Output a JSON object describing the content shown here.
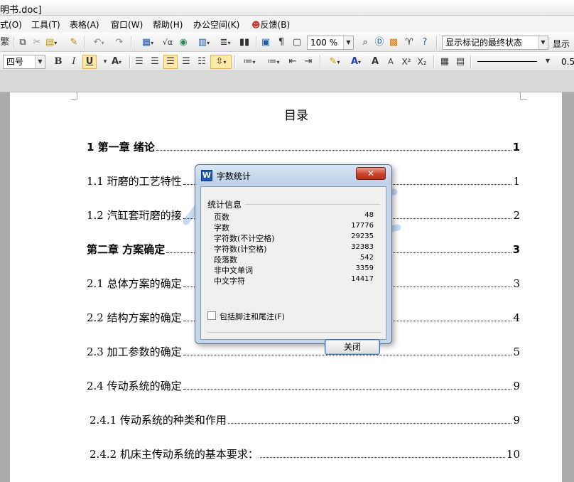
{
  "window": {
    "title": "明书.doc]"
  },
  "menu": [
    {
      "label": "式",
      "key": "(O)"
    },
    {
      "label": "工具",
      "key": "(T)"
    },
    {
      "label": "表格",
      "key": "(A)"
    },
    {
      "label": "窗口",
      "key": "(W)"
    },
    {
      "label": "帮助",
      "key": "(H)"
    },
    {
      "label": "办公空间",
      "key": "(K)"
    },
    {
      "label": "反馈",
      "key": "(B)"
    }
  ],
  "toolbar1": {
    "traditional_label": "繁",
    "zoom": "100 %",
    "markup_mode": "显示标记的最终状态",
    "show_label": "显示"
  },
  "toolbar2": {
    "font_size": "四号",
    "line_width": "0.5"
  },
  "document": {
    "title": "目录",
    "toc": [
      {
        "text": "1 第一章  绪论",
        "page": "1",
        "bold": true
      },
      {
        "text": "1.1 珩磨的工艺特性",
        "page": "1",
        "bold": false
      },
      {
        "text": "1.2 汽缸套珩磨的接",
        "page": "2",
        "bold": false
      },
      {
        "text": "第二章  方案确定",
        "page": "3",
        "bold": true
      },
      {
        "text": "2.1 总体方案的确定",
        "page": "3",
        "bold": false
      },
      {
        "text": "2.2 结构方案的确定",
        "page": "4",
        "bold": false
      },
      {
        "text": "2.3 加工参数的确定",
        "page": "5",
        "bold": false
      },
      {
        "text": "2.4 传动系统的确定",
        "page": "9",
        "bold": false
      },
      {
        "text": "2.4.1 传动系统的种类和作用",
        "page": "9",
        "bold": false
      },
      {
        "text": "2.4.2 机床主传动系统的基本要求：",
        "page": "10",
        "bold": false
      }
    ]
  },
  "watermark": {
    "text": "renrendoc.com"
  },
  "dialog": {
    "icon_letter": "W",
    "title": "字数统计",
    "group": "统计信息",
    "stats": [
      {
        "label": "页数",
        "value": "48"
      },
      {
        "label": "字数",
        "value": "17776"
      },
      {
        "label": "字符数(不计空格)",
        "value": "29235"
      },
      {
        "label": "字符数(计空格)",
        "value": "32383"
      },
      {
        "label": "段落数",
        "value": "542"
      },
      {
        "label": "非中文单词",
        "value": "3359"
      },
      {
        "label": "中文字符",
        "value": "14417"
      }
    ],
    "checkbox_label": "包括脚注和尾注(F)",
    "checkbox_checked": false,
    "close_button": "关闭"
  }
}
